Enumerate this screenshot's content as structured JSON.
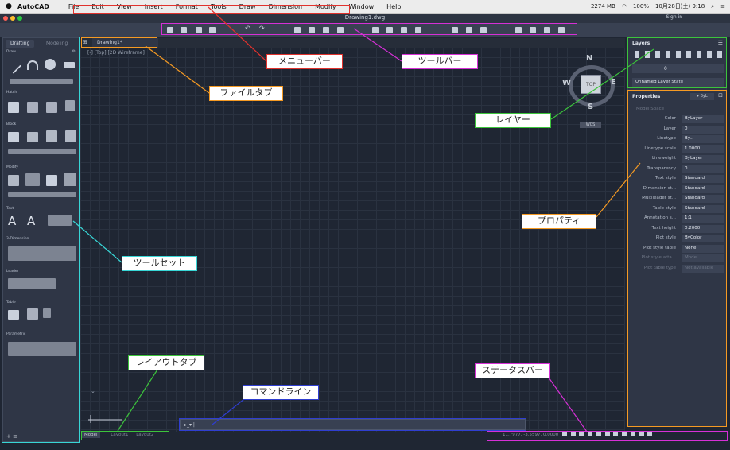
{
  "mac_menubar": {
    "app_name": "AutoCAD",
    "menus": [
      "File",
      "Edit",
      "View",
      "Insert",
      "Format",
      "Tools",
      "Draw",
      "Dimension",
      "Modify",
      "Window",
      "Help"
    ],
    "memory": "2274 MB",
    "battery": "100%",
    "datetime": "10月28日(土) 9:18"
  },
  "window": {
    "title": "Drawing1.dwg",
    "signin": "Sign in"
  },
  "palette": {
    "tabs": [
      "Drafting",
      "Modeling"
    ],
    "sections": [
      "Draw",
      "Hatch",
      "Block",
      "Modify",
      "Text",
      "3-Dimension",
      "Leader",
      "Table",
      "Parametric"
    ]
  },
  "file_tab": {
    "label": "Drawing1*"
  },
  "view_label": "[-] [Top] [2D Wireframe]",
  "viewcube": {
    "n": "N",
    "s": "S",
    "e": "E",
    "w": "W",
    "top": "TOP",
    "wcs": "WCS"
  },
  "layers": {
    "title": "Layers",
    "current_layer": "0",
    "layer_state": "Unnamed Layer State"
  },
  "properties": {
    "title": "Properties",
    "context": "Model Space",
    "rows": [
      {
        "label": "Color",
        "value": "ByLayer"
      },
      {
        "label": "Layer",
        "value": "0"
      },
      {
        "label": "Linetype",
        "value": "By..."
      },
      {
        "label": "Linetype scale",
        "value": "1.0000"
      },
      {
        "label": "Lineweight",
        "value": "ByLayer"
      },
      {
        "label": "Transparency",
        "value": "0"
      },
      {
        "label": "Text style",
        "value": "Standard"
      },
      {
        "label": "Dimension st...",
        "value": "Standard"
      },
      {
        "label": "Multileader st...",
        "value": "Standard"
      },
      {
        "label": "Table style",
        "value": "Standard"
      },
      {
        "label": "Annotation s...",
        "value": "1:1"
      },
      {
        "label": "Text height",
        "value": "0.2000"
      },
      {
        "label": "Plot style",
        "value": "ByColor"
      },
      {
        "label": "Plot style table",
        "value": "None"
      },
      {
        "label": "Plot style atta...",
        "value": "Model"
      },
      {
        "label": "Plot table type",
        "value": "Not available"
      }
    ]
  },
  "layout_tabs": [
    "Model",
    "Layout1",
    "Layout2"
  ],
  "command_line": {
    "prompt": "▸_▾ |"
  },
  "status_bar": {
    "coords": "11.7977, -3.5597, 0.0000"
  },
  "annotations": {
    "menubar": "メニューバー",
    "toolbar": "ツールバー",
    "filetab": "ファイルタブ",
    "layer": "レイヤー",
    "property": "プロパティ",
    "toolset": "ツールセット",
    "layouttab": "レイアウトタブ",
    "commandline": "コマンドライン",
    "statusbar": "ステータスバー"
  },
  "colors": {
    "red": "#e0322d",
    "magenta": "#d630d6",
    "orange": "#f59a23",
    "green": "#3cc43c",
    "cyan": "#38d6d6",
    "blue": "#2f3ed1"
  }
}
